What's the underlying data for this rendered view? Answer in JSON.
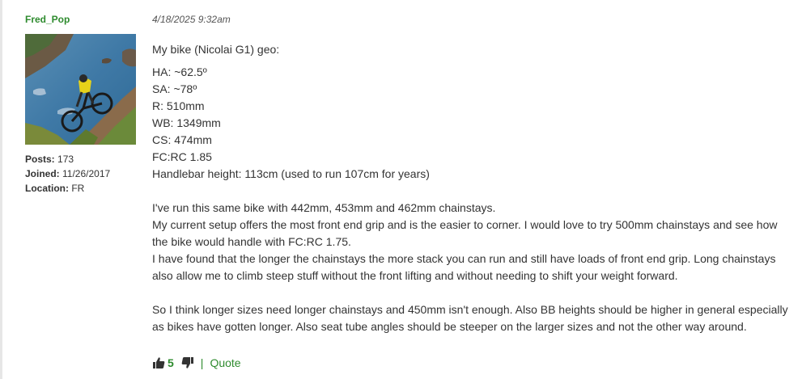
{
  "author": {
    "username": "Fred_Pop",
    "stats": {
      "posts_label": "Posts:",
      "posts_value": "173",
      "joined_label": "Joined:",
      "joined_value": "11/26/2017",
      "location_label": "Location:",
      "location_value": "FR"
    }
  },
  "post": {
    "timestamp": "4/18/2025 9:32am",
    "intro": "My bike (Nicolai G1) geo:",
    "specs": [
      "HA: ~62.5º",
      "SA: ~78º",
      "R: 510mm",
      "WB: 1349mm",
      "CS: 474mm",
      "FC:RC 1.85",
      "Handlebar height: 113cm (used to run 107cm for years)"
    ],
    "para1": [
      "I've run this same bike with 442mm, 453mm and 462mm chainstays.",
      "My current setup offers the most front end grip and is the easier to corner. I would love to try 500mm chainstays and see how the bike would handle with FC:RC 1.75.",
      "I have found that the longer the chainstays the more stack you can run and still have loads of front end grip. Long chainstays also allow me to climb steep stuff without the front lifting and without needing to shift your weight forward."
    ],
    "para2": "So I think longer sizes need longer chainstays and 450mm isn't enough. Also BB heights should be higher in general especially as bikes have gotten longer. Also seat tube angles should be steeper on the larger sizes and not the other way around."
  },
  "actions": {
    "like_icon": "thumbs-up-icon",
    "like_count": "5",
    "dislike_icon": "thumbs-down-icon",
    "separator": "|",
    "quote_label": "Quote"
  },
  "colors": {
    "accent": "#2e8b2e",
    "text": "#333333"
  }
}
